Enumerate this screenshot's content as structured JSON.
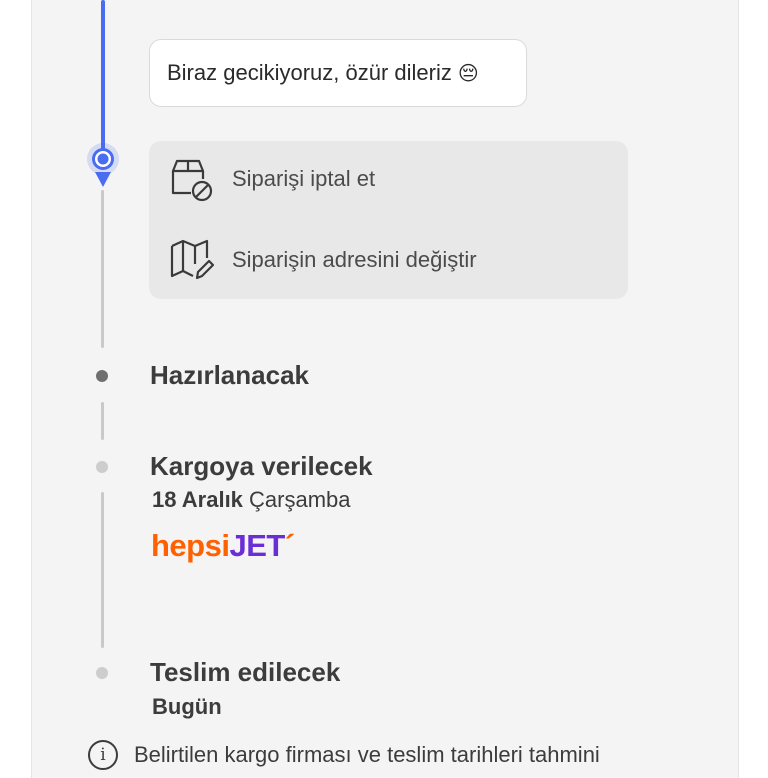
{
  "message": {
    "text": "Biraz gecikiyoruz, özür dileriz",
    "emoji": "😔"
  },
  "actions": [
    {
      "label": "Siparişi iptal et",
      "icon": "cancel-box-icon"
    },
    {
      "label": "Siparişin adresini değiştir",
      "icon": "map-edit-icon"
    }
  ],
  "steps": {
    "preparing": {
      "title": "Hazırlanacak"
    },
    "shipping": {
      "title": "Kargoya verilecek",
      "date_bold": "18 Aralık",
      "date_rest": " Çarşamba",
      "carrier_part1": "hepsi",
      "carrier_part2": "JET",
      "carrier_mark": "´"
    },
    "delivery": {
      "title": "Teslim edilecek",
      "date": "Bugün"
    }
  },
  "footer_note": {
    "icon": "info-icon",
    "text": "Belirtilen kargo firması ve teslim tarihleri tahmini"
  },
  "colors": {
    "accent": "#4a6cf0",
    "hepsi_orange": "#ff6000",
    "jet_purple": "#6a2dd6"
  }
}
